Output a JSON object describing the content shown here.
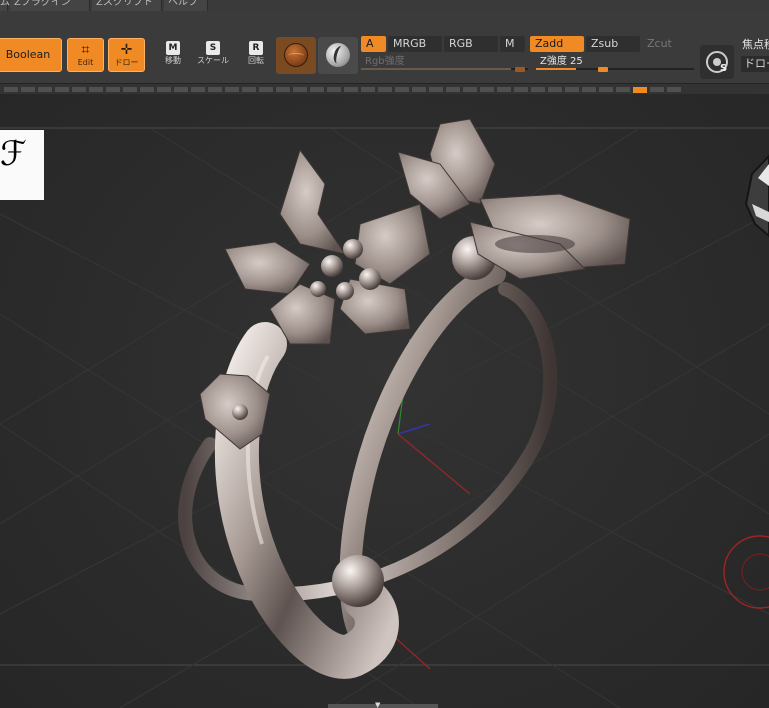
{
  "menu": {
    "items": [
      "ム",
      "Zプラグイン",
      "Zスクリプト",
      "ヘルプ"
    ]
  },
  "toolbar": {
    "boolean_label": "Boolean",
    "edit": {
      "icon": "edit-icon",
      "label": "Edit"
    },
    "draw": {
      "icon": "draw-crosshair-icon",
      "label": "ドロー"
    },
    "move": {
      "key": "M",
      "label": "移動"
    },
    "scale": {
      "key": "S",
      "label": "スケール"
    },
    "rotate": {
      "key": "R",
      "label": "回転"
    },
    "modes": {
      "a": "A",
      "mrgb": "MRGB",
      "rgb": "RGB",
      "m": "M",
      "zadd": "Zadd",
      "zsub": "Zsub",
      "zcut": "Zcut"
    },
    "rgb_intensity_label": "Rgb強度",
    "z_intensity_label": "Z強度 25",
    "z_intensity_value": 25,
    "focal_key": "S",
    "focal_label": "焦点移",
    "draw_select": "ドロー"
  },
  "canvas": {
    "logo_glyph": "ℱ"
  },
  "colors": {
    "accent": "#f08a24",
    "panel": "#3b3b3b",
    "canvas": "#2b2b2b"
  }
}
